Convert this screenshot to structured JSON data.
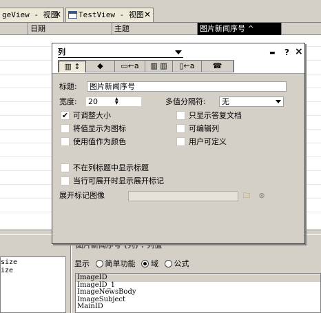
{
  "tabs": [
    {
      "label": "geView - 视图"
    },
    {
      "label": "TestView - 视图"
    }
  ],
  "grid_header": {
    "col_date": "日期",
    "col_subject": "主题",
    "col_selected": "图片新闻序号 ^"
  },
  "dialog": {
    "combo_value": "列",
    "pin_symbol": "▬",
    "help_symbol": "?",
    "close_symbol": "×",
    "toolbar": [
      "▥ ↕",
      "◆",
      "▭←a",
      "▥ ▥",
      "▯←a",
      "☎"
    ],
    "title_label": "标题:",
    "title_value": "图片新闻序号",
    "width_label": "宽度:",
    "width_value": "20",
    "separator_label": "多值分隔符:",
    "separator_value": "无",
    "options_left": [
      {
        "label": "可调整大小",
        "checked": "✔"
      },
      {
        "label": "将值显示为图标",
        "checked": ""
      },
      {
        "label": "使用值作为颜色",
        "checked": ""
      }
    ],
    "options_right": [
      {
        "label": "只显示答复文档",
        "checked": ""
      },
      {
        "label": "可编辑列",
        "checked": ""
      },
      {
        "label": "用户可定义",
        "checked": ""
      }
    ],
    "options_bottom": [
      {
        "label": "不在列标题中显示标题",
        "checked": ""
      },
      {
        "label": "当行可展开时显示展开标记",
        "checked": ""
      }
    ],
    "twistie_label": "展开标记图像"
  },
  "left_panel": {
    "items": [
      "size",
      "ize"
    ]
  },
  "right_panel": {
    "title": "图片新闻序号 (列) : 列值",
    "display_label": "显示",
    "radio_simple": "简单功能",
    "radio_field": "域",
    "radio_formula": "公式",
    "fields": [
      "ImageID",
      "ImageID_1",
      "ImageNewsBody",
      "ImageSubject",
      "MainID"
    ]
  }
}
